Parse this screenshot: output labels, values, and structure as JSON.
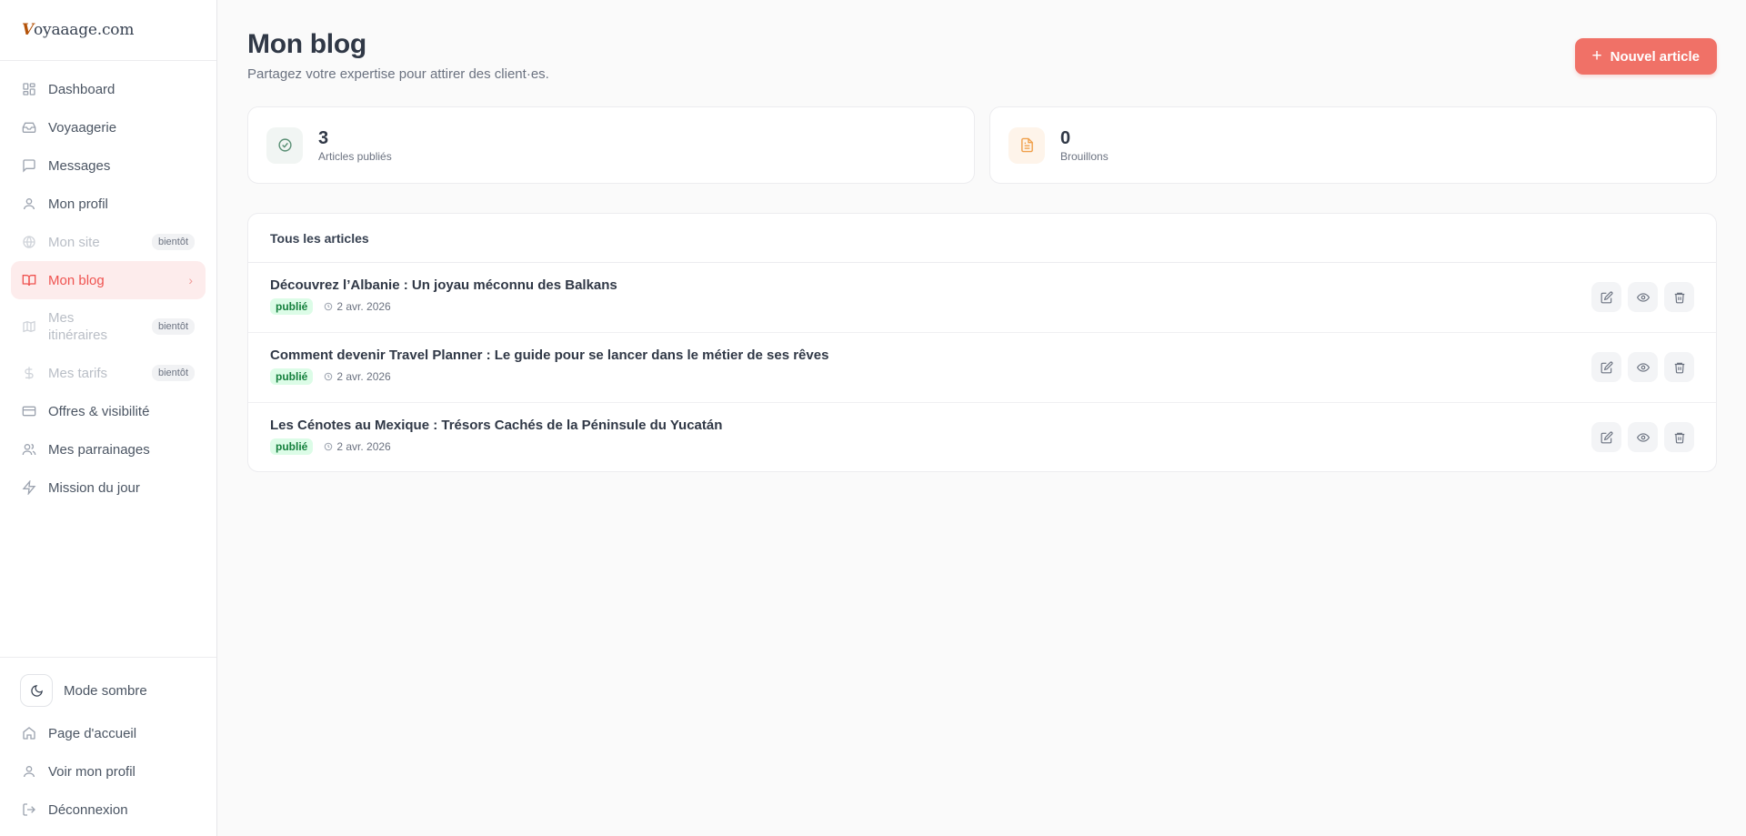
{
  "brand": {
    "prefix": "V",
    "rest": "oyaaage.com"
  },
  "sidebar": {
    "items": [
      {
        "label": "Dashboard",
        "icon": "dashboard-icon"
      },
      {
        "label": "Voyaagerie",
        "icon": "inbox-icon"
      },
      {
        "label": "Messages",
        "icon": "message-icon"
      },
      {
        "label": "Mon profil",
        "icon": "user-icon"
      },
      {
        "label": "Mon site",
        "icon": "globe-icon",
        "badge": "bientôt"
      },
      {
        "label": "Mon blog",
        "icon": "book-icon"
      },
      {
        "label": "Mes itinéraires",
        "icon": "map-icon",
        "badge": "bientôt"
      },
      {
        "label": "Mes tarifs",
        "icon": "dollar-icon",
        "badge": "bientôt"
      },
      {
        "label": "Offres & visibilité",
        "icon": "card-icon"
      },
      {
        "label": "Mes parrainages",
        "icon": "users-icon"
      },
      {
        "label": "Mission du jour",
        "icon": "bolt-icon"
      }
    ],
    "bottom": {
      "dark_mode": "Mode sombre",
      "home": "Page d'accueil",
      "view_profile": "Voir mon profil",
      "logout": "Déconnexion"
    }
  },
  "header": {
    "title": "Mon blog",
    "subtitle": "Partagez votre expertise pour attirer des client·es.",
    "new_button": "Nouvel article"
  },
  "stats": {
    "published": {
      "value": "3",
      "label": "Articles publiés"
    },
    "drafts": {
      "value": "0",
      "label": "Brouillons"
    }
  },
  "articles": {
    "heading": "Tous les articles",
    "rows": [
      {
        "title": "Découvrez l’Albanie : Un joyau méconnu des Balkans",
        "status": "publié",
        "date": "2 avr. 2026"
      },
      {
        "title": "Comment devenir Travel Planner : Le guide pour se lancer dans le métier de ses rêves",
        "status": "publié",
        "date": "2 avr. 2026"
      },
      {
        "title": "Les Cénotes au Mexique : Trésors Cachés de la Péninsule du Yucatán",
        "status": "publié",
        "date": "2 avr. 2026"
      }
    ]
  },
  "colors": {
    "accent": "#f07167",
    "active_bg": "#fdecec",
    "success": "#15803d",
    "warning": "#f0a04b"
  }
}
